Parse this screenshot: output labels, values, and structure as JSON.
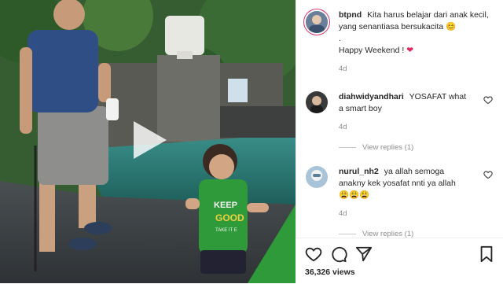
{
  "post": {
    "username": "btpnd",
    "caption_line1": "Kita harus belajar dari anak kecil, yang senantiasa bersukacita",
    "caption_emoji": "😊",
    "caption_dot": ".",
    "caption_line2": "Happy Weekend !",
    "caption_heart": "❤",
    "time": "4d"
  },
  "comments": [
    {
      "username": "diahwidyandhari",
      "text": "YOSAFAT what a smart boy",
      "time": "4d",
      "replies": "View replies (1)"
    },
    {
      "username": "nurul_nh2",
      "text": "ya allah semoga anakny kek yosafat nnti ya allah",
      "emojis": "😩😩😩",
      "time": "4d",
      "replies": "View replies (1)"
    }
  ],
  "video_text": {
    "shirt_line1": "KEEP",
    "shirt_line2": "GOOD",
    "shirt_line3": "TAKE IT E"
  },
  "footer": {
    "views": "36,326 views"
  },
  "icons": {
    "play": "play-icon",
    "like": "heart-icon",
    "comment": "comment-icon",
    "share": "share-icon",
    "save": "bookmark-icon"
  },
  "colors": {
    "avatar_ring": "#d1306e",
    "text": "#262626",
    "muted": "#8e8e8e"
  }
}
